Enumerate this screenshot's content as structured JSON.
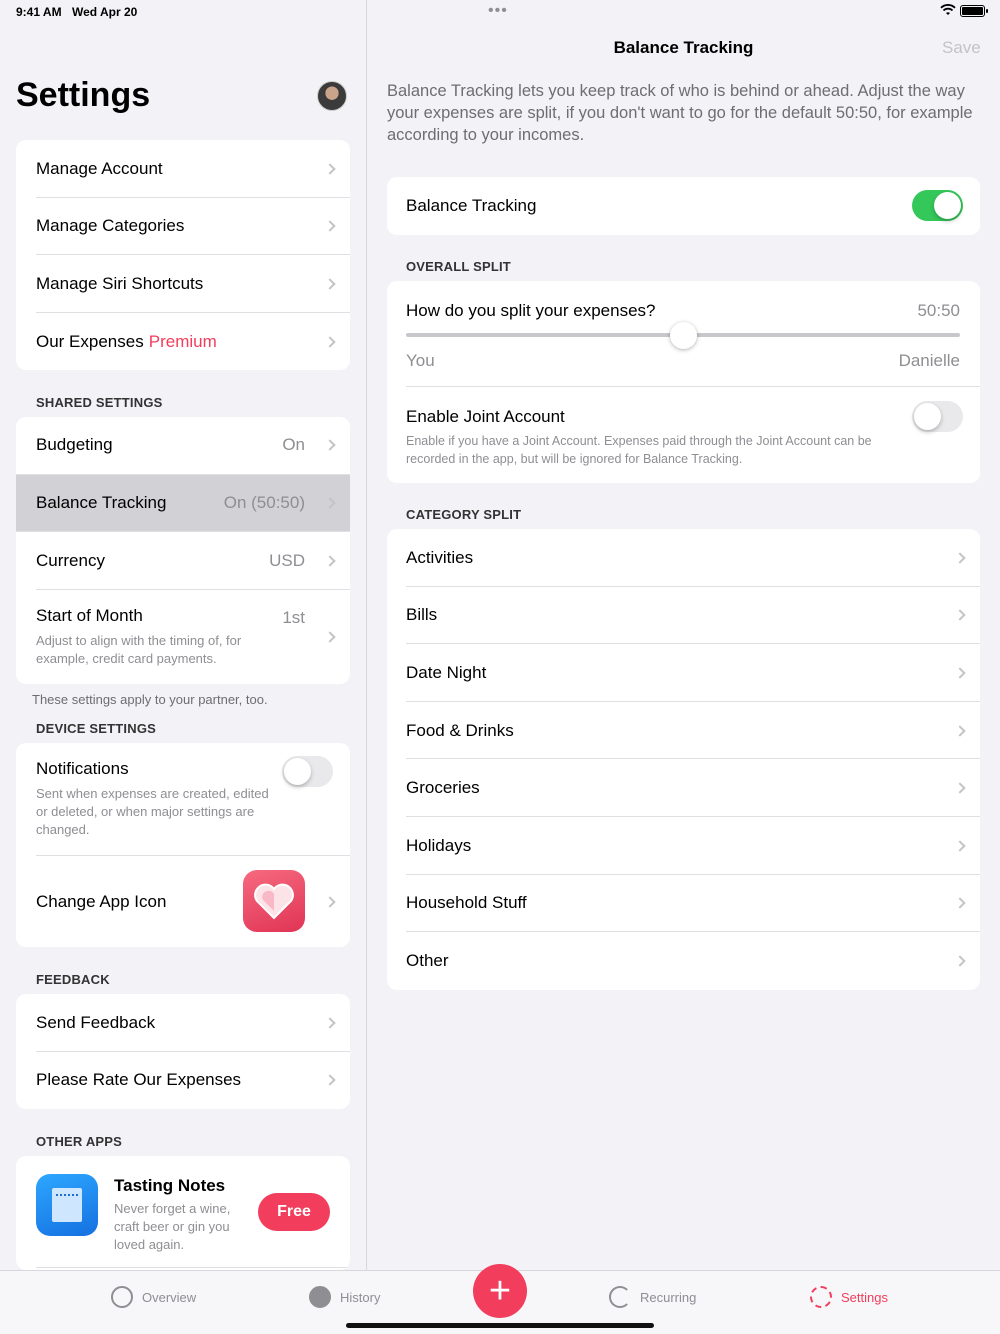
{
  "status": {
    "time": "9:41 AM",
    "date": "Wed Apr 20"
  },
  "left": {
    "title": "Settings",
    "account_group": [
      {
        "label": "Manage Account"
      },
      {
        "label": "Manage Categories"
      },
      {
        "label": "Manage Siri Shortcuts"
      },
      {
        "label": "Our Expenses",
        "badge": "Premium"
      }
    ],
    "shared": {
      "header": "SHARED SETTINGS",
      "budgeting": {
        "label": "Budgeting",
        "value": "On"
      },
      "balance": {
        "label": "Balance Tracking",
        "value": "On (50:50)"
      },
      "currency": {
        "label": "Currency",
        "value": "USD"
      },
      "start_month": {
        "label": "Start of Month",
        "value": "1st",
        "sub": "Adjust to align with the timing of, for example, credit card payments."
      },
      "footer": "These settings apply to your partner, too."
    },
    "device": {
      "header": "DEVICE SETTINGS",
      "notifications": {
        "label": "Notifications",
        "sub": "Sent when expenses are created, edited or deleted, or when major settings are changed.",
        "enabled": false
      },
      "app_icon": {
        "label": "Change App Icon"
      }
    },
    "feedback": {
      "header": "FEEDBACK",
      "items": [
        {
          "label": "Send Feedback"
        },
        {
          "label": "Please Rate Our Expenses"
        }
      ]
    },
    "other_apps": {
      "header": "OTHER APPS",
      "app": {
        "name": "Tasting Notes",
        "description": "Never forget a wine, craft beer or gin you loved again.",
        "price": "Free"
      }
    }
  },
  "right": {
    "title": "Balance Tracking",
    "save": "Save",
    "intro": "Balance Tracking lets you keep track of who is behind or ahead. Adjust the way your expenses are split, if you don't want to go for the default 50:50, for example according to your incomes.",
    "toggle_label": "Balance Tracking",
    "toggle_on": true,
    "overall": {
      "header": "OVERALL SPLIT",
      "question": "How do you split your expenses?",
      "value": "50:50",
      "slider_fraction": 0.5,
      "left_name": "You",
      "right_name": "Danielle",
      "joint_label": "Enable Joint Account",
      "joint_sub": "Enable if you have a Joint Account. Expenses paid through the Joint Account can be recorded in the app, but will be ignored for Balance Tracking.",
      "joint_on": false
    },
    "category": {
      "header": "CATEGORY SPLIT",
      "items": [
        "Activities",
        "Bills",
        "Date Night",
        "Food & Drinks",
        "Groceries",
        "Holidays",
        "Household Stuff",
        "Other"
      ]
    }
  },
  "tabs": [
    {
      "label": "Overview",
      "icon": "gauge-icon"
    },
    {
      "label": "History",
      "icon": "clock-icon"
    },
    {
      "label": "Recurring",
      "icon": "repeat-icon"
    },
    {
      "label": "Settings",
      "icon": "gear-icon",
      "active": true
    }
  ],
  "colors": {
    "accent": "#f23d5c",
    "toggle_on": "#34c759"
  }
}
